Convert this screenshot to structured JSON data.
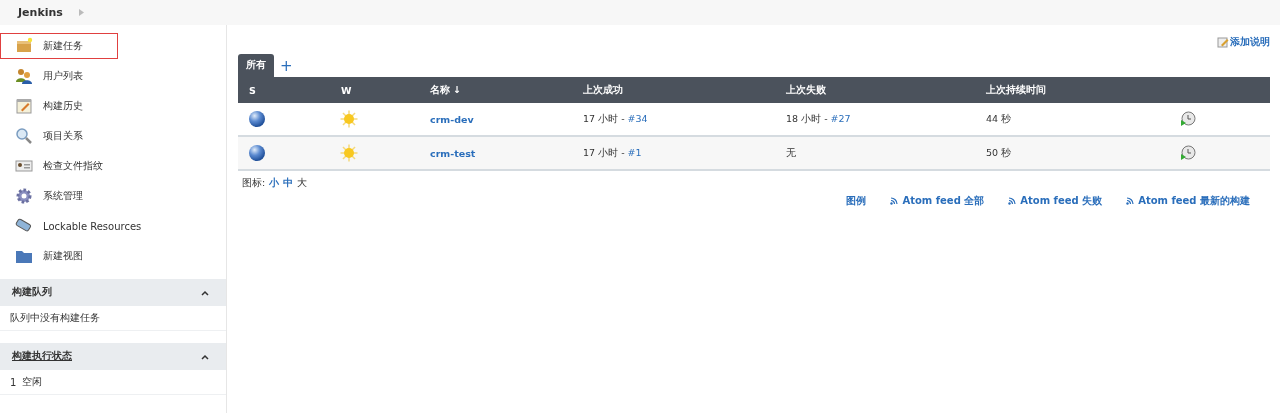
{
  "breadcrumb": {
    "title": "Jenkins"
  },
  "sidebar": {
    "items": [
      {
        "label": "新建任务",
        "highlighted": true
      },
      {
        "label": "用户列表",
        "highlighted": false
      },
      {
        "label": "构建历史",
        "highlighted": false
      },
      {
        "label": "项目关系",
        "highlighted": false
      },
      {
        "label": "检查文件指纹",
        "highlighted": false
      },
      {
        "label": "系统管理",
        "highlighted": false
      },
      {
        "label": "Lockable Resources",
        "highlighted": false
      },
      {
        "label": "新建视图",
        "highlighted": false
      }
    ]
  },
  "build_queue": {
    "title": "构建队列",
    "expanded": true,
    "message": "队列中没有构建任务"
  },
  "executors": {
    "title": "构建执行状态",
    "expanded": true,
    "rows": [
      {
        "number": "1",
        "status": "空闲"
      }
    ]
  },
  "add_description": "添加说明",
  "tabs": [
    {
      "label": "所有",
      "selected": true
    }
  ],
  "add_tab": "+",
  "table": {
    "columns": [
      "S",
      "W",
      "名称 ↓",
      "上次成功",
      "上次失败",
      "上次持续时间"
    ],
    "rows": [
      {
        "name": "crm-dev",
        "last_success": {
          "time": "17 小时 - ",
          "build": "#34"
        },
        "last_failure": {
          "time": "18 小时 - ",
          "build": "#27"
        },
        "duration": "44 秒"
      },
      {
        "name": "crm-test",
        "last_success": {
          "time": "17 小时 - ",
          "build": "#1"
        },
        "last_failure": {
          "time": "无"
        },
        "duration": "50 秒"
      }
    ]
  },
  "icon_size": {
    "label": "图标:",
    "sizes": [
      {
        "label": "小",
        "selected": false
      },
      {
        "label": "中",
        "selected": false
      },
      {
        "label": "大",
        "selected": true
      }
    ]
  },
  "footer_links": [
    {
      "label": "图例",
      "kind": "plain"
    },
    {
      "label": "Atom feed 全部",
      "kind": "feed"
    },
    {
      "label": "Atom feed 失败",
      "kind": "feed"
    },
    {
      "label": "Atom feed 最新的构建",
      "kind": "feed"
    }
  ]
}
